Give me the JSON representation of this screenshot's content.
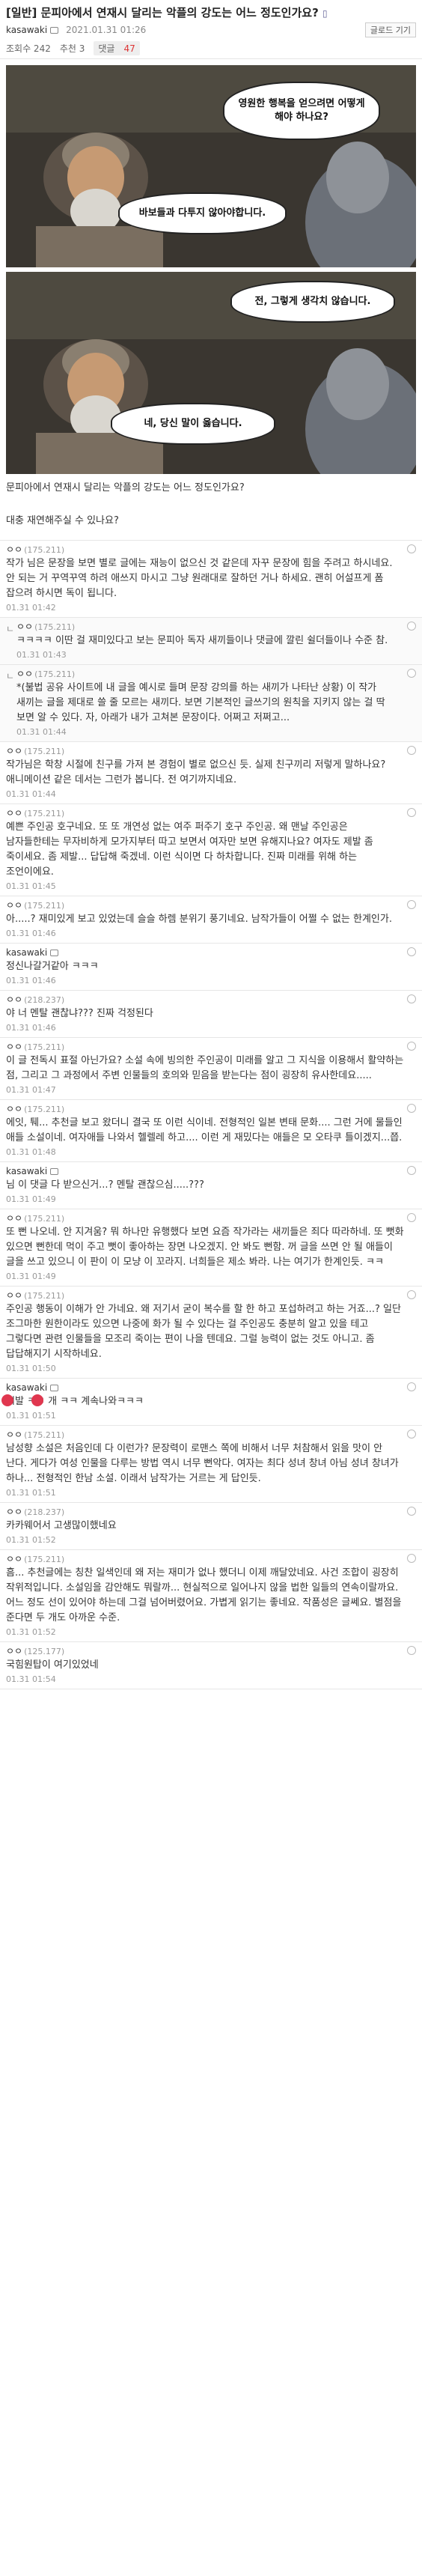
{
  "post": {
    "title": "[일반] 문피아에서 연재시 달리는 악플의 강도는 어느 정도인가요?",
    "phone_icon_label": "▯",
    "author": "kasawaki",
    "date": "2021.01.31 01:26",
    "list_button": "글로드 기기",
    "views_label": "조회수 242",
    "recommend_label": "추천 3",
    "comments_label": "댓글",
    "comments_count": "47",
    "bubbles": [
      "영원한 행복을 얻으려면 어떻게 해야 하나요?",
      "바보들과 다투지 않아야합니다.",
      "전, 그렇게 생각치 않습니다.",
      "네, 당신 말이 옳습니다."
    ],
    "body": [
      "문피아에서 연재시 달리는 악플의 강도는 어느 정도인가요?",
      "대충 재연해주실 수 있나요?"
    ]
  },
  "colors": {
    "accent": "#e0374f",
    "border": "#e6e6e6",
    "meta": "#999999"
  },
  "comments": [
    {
      "type": "c",
      "author": "ㅇㅇ",
      "ip": "(175.211)",
      "text": "작가 님은 문장을 보면 별로 글에는 재능이 없으신 것 같은데 자꾸 문장에 힘을 주려고 하시네요. 안 되는 거 꾸역꾸역 하려 애쓰지 마시고 그냥 원래대로 잘하던 거나 하세요. 괜히 어설프게 폼 잡으려 하시면 독이 됩니다.",
      "date": "01.31 01:42"
    },
    {
      "type": "r",
      "author": "ㅇㅇ",
      "ip": "(175.211)",
      "text": "ㅋㅋㅋㅋ 이딴 걸 재미있다고 보는 문피아 독자 새끼들이나 댓글에 깔린 쉴더들이나 수준 참.",
      "date": "01.31 01:43"
    },
    {
      "type": "r",
      "author": "ㅇㅇ",
      "ip": "(175.211)",
      "text": "*(불법 공유 사이트에 내 글을 예시로 들며 문장 강의를 하는 새끼가 나타난 상황) 이 작가 새끼는 글을 제대로 쓸 줄 모르는 새끼다. 보면 기본적인 글쓰기의 원칙을 지키지 않는 걸 딱 보면 알 수 있다. 자, 아래가 내가 고쳐본 문장이다. 어쩌고 저쩌고...",
      "date": "01.31 01:44"
    },
    {
      "type": "c",
      "author": "ㅇㅇ",
      "ip": "(175.211)",
      "text": "작가님은 학창 시절에 친구를 가져 본 경험이 별로 없으신 듯. 실제 친구끼리 저렇게 말하나요? 애니메이션 같은 데서는 그런가 봅니다. 전 여기까지네요.",
      "date": "01.31 01:44"
    },
    {
      "type": "c",
      "author": "ㅇㅇ",
      "ip": "(175.211)",
      "text": "예쁜 주인공 호구네요. 또 또 개연성 없는 여주 퍼주기 호구 주인공. 왜 맨날 주인공은 남자들한테는 무자비하게 모가지부터 따고 보면서 여자만 보면 유해지나요? 여자도 제발 좀 죽이세요. 좀 제발... 답답해 죽겠네. 이런 식이면 다 하차합니다. 진짜 미래를 위해 하는 조언이에요.",
      "date": "01.31 01:45"
    },
    {
      "type": "c",
      "author": "ㅇㅇ",
      "ip": "(175.211)",
      "text": "아.....? 재미있게 보고 있었는데 슬슬 하렘 분위기 풍기네요. 남작가들이 어쩔 수 없는 한계인가.",
      "date": "01.31 01:46"
    },
    {
      "type": "c",
      "author": "kasawaki",
      "ip": "",
      "badge": true,
      "text": "정신나갈거같아 ㅋㅋㅋ",
      "date": "01.31 01:46"
    },
    {
      "type": "c",
      "author": "ㅇㅇ",
      "ip": "(218.237)",
      "text": "야 너 멘탈 괜찮냐??? 진짜 걱정된다",
      "date": "01.31 01:46"
    },
    {
      "type": "c",
      "author": "ㅇㅇ",
      "ip": "(175.211)",
      "text": "이 글 전독시 표절 아닌가요? 소설 속에 빙의한 주인공이 미래를 알고 그 지식을 이용해서 활약하는 점, 그리고 그 과정에서 주변 인물들의 호의와 믿음을 받는다는 점이 굉장히 유사한데요.....",
      "date": "01.31 01:47"
    },
    {
      "type": "c",
      "author": "ㅇㅇ",
      "ip": "(175.211)",
      "text": "에잇, 퉤... 추천글 보고 왔더니 결국 또 이런 식이네. 전형적인 일본 변태 문화.... 그런 거에 물들인 애들 소설이네. 여자애들 나와서 헬렐레 하고.... 이런 게 재밌다는 애들은 모 오타쿠 틀이겠지...쯥.",
      "date": "01.31 01:48"
    },
    {
      "type": "c",
      "author": "kasawaki",
      "ip": "",
      "badge": true,
      "text": "님 이 댓글 다 받으신거...? 멘탈 괜찮으심.....???",
      "date": "01.31 01:49"
    },
    {
      "type": "c",
      "author": "ㅇㅇ",
      "ip": "(175.211)",
      "text": "또 뻔 나오네. 안 지겨움? 뭐 하나만 유행했다 보면 요즘 작가라는 새끼들은 죄다 따라하네. 또 뻣화 있으면 뻔한데 먹이 주고 뻣이 좋아하는 장면 나오겠지. 안 봐도 뻔함. 꺼 글을 쓰면 안 될 애들이 글을 쓰고 있으니 이 판이 이 모냥 이 꼬라지. 너희들은 제소 봐라. 나는 여기가 한계인듯. ㅋㅋ",
      "date": "01.31 01:49"
    },
    {
      "type": "c",
      "author": "ㅇㅇ",
      "ip": "(175.211)",
      "text": "주인공 행동이 이해가 안 가네요. 왜 저기서 굳이 복수를 할 한 하고 포섭하려고 하는 거죠...? 일단 조그마한 원한이라도 있으면 나중에 화가 될 수 있다는 걸 주인공도 충분히 알고 있을 테고 그렇다면 관련 인물들을 모조리 죽이는 편이 나을 텐데요. 그럴 능력이 없는 것도 아니고. 좀 답답해지기 시작하네요.",
      "date": "01.31 01:50"
    },
    {
      "type": "c",
      "author": "kasawaki",
      "ip": "",
      "badge": true,
      "text": "씨발 ㅋㅋ 개 ㅋㅋ 계속나와ㅋㅋㅋ",
      "date": "01.31 01:51",
      "dots": true
    },
    {
      "type": "c",
      "author": "ㅇㅇ",
      "ip": "(175.211)",
      "text": "남성향 소설은 처음인데 다 이런가? 문장력이 로맨스 쪽에 비해서 너무 처참해서 읽을 맛이 안 난다. 게다가 여성 인물을 다루는 방법 역시 너무 뻔악다. 여자는 최다 성녀 창녀 아님 성녀 창녀가 하나... 전형적인 한남 소설. 이래서 남작가는 거르는 게 답인듯.",
      "date": "01.31 01:51"
    },
    {
      "type": "c",
      "author": "ㅇㅇ",
      "ip": "(218.237)",
      "text": "카카웨어서 고생많이했네요",
      "date": "01.31 01:52"
    },
    {
      "type": "c",
      "author": "ㅇㅇ",
      "ip": "(175.211)",
      "text": "흠... 추천글에는 칭찬 일색인데 왜 저는 재미가 없나 했더니 이제 깨달았네요. 사건 조합이 굉장히 작위적입니다. 소설임을 감안해도 뭐랄까... 현실적으로 일어나지 않을 법한 일들의 연속이랄까요. 어느 정도 선이 있어야 하는데 그걸 넘어버렸어요. 가볍게 읽기는 좋네요. 작품성은 글쎄요. 별점을 준다면 두 개도 아까운 수준.",
      "date": "01.31 01:52"
    },
    {
      "type": "c",
      "author": "ㅇㅇ",
      "ip": "(125.177)",
      "text": "국힘원탑이 여기있었네",
      "date": "01.31 01:54"
    }
  ]
}
